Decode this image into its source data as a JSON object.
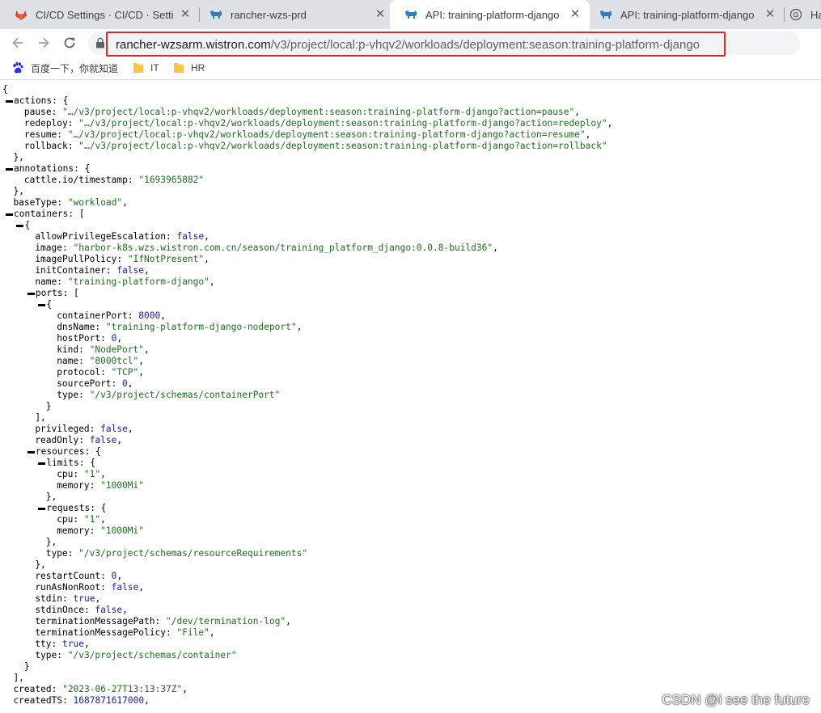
{
  "tabs": [
    {
      "title": "CI/CD Settings · CI/CD · Settings",
      "icon": "gitlab-icon",
      "active": false
    },
    {
      "title": "rancher-wzs-prd",
      "icon": "rancher-icon",
      "active": false
    },
    {
      "title": "API: training-platform-django",
      "icon": "rancher-icon",
      "active": true
    },
    {
      "title": "API: training-platform-django",
      "icon": "rancher-icon",
      "active": false
    },
    {
      "title": "Ha",
      "icon": "globe-icon",
      "active": false
    }
  ],
  "address_bar": {
    "host": "rancher-wzsarm.wistron.com",
    "path": "/v3/project/local:p-vhqv2/workloads/deployment:season:training-platform-django"
  },
  "bookmarks": [
    {
      "label": "百度一下，你就知道",
      "icon": "baidu-paw-icon"
    },
    {
      "label": "IT",
      "icon": "folder-icon"
    },
    {
      "label": "HR",
      "icon": "folder-icon"
    }
  ],
  "colors": {
    "highlight_border": "#d92b2b",
    "string": "#1e6e1e",
    "literal": "#1a1aa6"
  },
  "json_lines": [
    {
      "i": 0,
      "t": [
        [
          "p",
          "{"
        ]
      ]
    },
    {
      "i": 0,
      "c": true,
      "t": [
        [
          "k",
          "actions"
        ],
        [
          "p",
          ": {"
        ]
      ]
    },
    {
      "i": 4,
      "t": [
        [
          "k",
          "pause"
        ],
        [
          "p",
          ": "
        ],
        [
          "s",
          "\"…/v3/project/local:p-vhqv2/workloads/deployment:season:training-platform-django?action=pause\""
        ],
        [
          "p",
          ","
        ]
      ]
    },
    {
      "i": 4,
      "t": [
        [
          "k",
          "redeploy"
        ],
        [
          "p",
          ": "
        ],
        [
          "s",
          "\"…/v3/project/local:p-vhqv2/workloads/deployment:season:training-platform-django?action=redeploy\""
        ],
        [
          "p",
          ","
        ]
      ]
    },
    {
      "i": 4,
      "t": [
        [
          "k",
          "resume"
        ],
        [
          "p",
          ": "
        ],
        [
          "s",
          "\"…/v3/project/local:p-vhqv2/workloads/deployment:season:training-platform-django?action=resume\""
        ],
        [
          "p",
          ","
        ]
      ]
    },
    {
      "i": 4,
      "t": [
        [
          "k",
          "rollback"
        ],
        [
          "p",
          ": "
        ],
        [
          "s",
          "\"…/v3/project/local:p-vhqv2/workloads/deployment:season:training-platform-django?action=rollback\""
        ]
      ]
    },
    {
      "i": 2,
      "t": [
        [
          "p",
          "},"
        ]
      ]
    },
    {
      "i": 0,
      "c": true,
      "t": [
        [
          "k",
          "annotations"
        ],
        [
          "p",
          ": {"
        ]
      ]
    },
    {
      "i": 4,
      "t": [
        [
          "k",
          "cattle.io/timestamp"
        ],
        [
          "p",
          ": "
        ],
        [
          "s",
          "\"1693965882\""
        ]
      ]
    },
    {
      "i": 2,
      "t": [
        [
          "p",
          "},"
        ]
      ]
    },
    {
      "i": 2,
      "t": [
        [
          "k",
          "baseType"
        ],
        [
          "p",
          ": "
        ],
        [
          "s",
          "\"workload\""
        ],
        [
          "p",
          ","
        ]
      ]
    },
    {
      "i": 0,
      "c": true,
      "t": [
        [
          "k",
          "containers"
        ],
        [
          "p",
          ": ["
        ]
      ]
    },
    {
      "i": 2,
      "c": true,
      "t": [
        [
          "p",
          "{"
        ]
      ]
    },
    {
      "i": 6,
      "t": [
        [
          "k",
          "allowPrivilegeEscalation"
        ],
        [
          "p",
          ": "
        ],
        [
          "b",
          "false"
        ],
        [
          "p",
          ","
        ]
      ]
    },
    {
      "i": 6,
      "t": [
        [
          "k",
          "image"
        ],
        [
          "p",
          ": "
        ],
        [
          "s",
          "\"harbor-k8s.wzs.wistron.com.cn/season/training_platform_django:0.0.8-build36\""
        ],
        [
          "p",
          ","
        ]
      ]
    },
    {
      "i": 6,
      "t": [
        [
          "k",
          "imagePullPolicy"
        ],
        [
          "p",
          ": "
        ],
        [
          "s",
          "\"IfNotPresent\""
        ],
        [
          "p",
          ","
        ]
      ]
    },
    {
      "i": 6,
      "t": [
        [
          "k",
          "initContainer"
        ],
        [
          "p",
          ": "
        ],
        [
          "b",
          "false"
        ],
        [
          "p",
          ","
        ]
      ]
    },
    {
      "i": 6,
      "t": [
        [
          "k",
          "name"
        ],
        [
          "p",
          ": "
        ],
        [
          "s",
          "\"training-platform-django\""
        ],
        [
          "p",
          ","
        ]
      ]
    },
    {
      "i": 4,
      "c": true,
      "t": [
        [
          "k",
          "ports"
        ],
        [
          "p",
          ": ["
        ]
      ]
    },
    {
      "i": 6,
      "c": true,
      "t": [
        [
          "p",
          "{"
        ]
      ]
    },
    {
      "i": 10,
      "t": [
        [
          "k",
          "containerPort"
        ],
        [
          "p",
          ": "
        ],
        [
          "n",
          "8000"
        ],
        [
          "p",
          ","
        ]
      ]
    },
    {
      "i": 10,
      "t": [
        [
          "k",
          "dnsName"
        ],
        [
          "p",
          ": "
        ],
        [
          "s",
          "\"training-platform-django-nodeport\""
        ],
        [
          "p",
          ","
        ]
      ]
    },
    {
      "i": 10,
      "t": [
        [
          "k",
          "hostPort"
        ],
        [
          "p",
          ": "
        ],
        [
          "n",
          "0"
        ],
        [
          "p",
          ","
        ]
      ]
    },
    {
      "i": 10,
      "t": [
        [
          "k",
          "kind"
        ],
        [
          "p",
          ": "
        ],
        [
          "s",
          "\"NodePort\""
        ],
        [
          "p",
          ","
        ]
      ]
    },
    {
      "i": 10,
      "t": [
        [
          "k",
          "name"
        ],
        [
          "p",
          ": "
        ],
        [
          "s",
          "\"8000tcl\""
        ],
        [
          "p",
          ","
        ]
      ]
    },
    {
      "i": 10,
      "t": [
        [
          "k",
          "protocol"
        ],
        [
          "p",
          ": "
        ],
        [
          "s",
          "\"TCP\""
        ],
        [
          "p",
          ","
        ]
      ]
    },
    {
      "i": 10,
      "t": [
        [
          "k",
          "sourcePort"
        ],
        [
          "p",
          ": "
        ],
        [
          "n",
          "0"
        ],
        [
          "p",
          ","
        ]
      ]
    },
    {
      "i": 10,
      "t": [
        [
          "k",
          "type"
        ],
        [
          "p",
          ": "
        ],
        [
          "s",
          "\"/v3/project/schemas/containerPort\""
        ]
      ]
    },
    {
      "i": 8,
      "t": [
        [
          "p",
          "}"
        ]
      ]
    },
    {
      "i": 6,
      "t": [
        [
          "p",
          "],"
        ]
      ]
    },
    {
      "i": 6,
      "t": [
        [
          "k",
          "privileged"
        ],
        [
          "p",
          ": "
        ],
        [
          "b",
          "false"
        ],
        [
          "p",
          ","
        ]
      ]
    },
    {
      "i": 6,
      "t": [
        [
          "k",
          "readOnly"
        ],
        [
          "p",
          ": "
        ],
        [
          "b",
          "false"
        ],
        [
          "p",
          ","
        ]
      ]
    },
    {
      "i": 4,
      "c": true,
      "t": [
        [
          "k",
          "resources"
        ],
        [
          "p",
          ": {"
        ]
      ]
    },
    {
      "i": 6,
      "c": true,
      "t": [
        [
          "k",
          "limits"
        ],
        [
          "p",
          ": {"
        ]
      ]
    },
    {
      "i": 10,
      "t": [
        [
          "k",
          "cpu"
        ],
        [
          "p",
          ": "
        ],
        [
          "s",
          "\"1\""
        ],
        [
          "p",
          ","
        ]
      ]
    },
    {
      "i": 10,
      "t": [
        [
          "k",
          "memory"
        ],
        [
          "p",
          ": "
        ],
        [
          "s",
          "\"1000Mi\""
        ]
      ]
    },
    {
      "i": 8,
      "t": [
        [
          "p",
          "},"
        ]
      ]
    },
    {
      "i": 6,
      "c": true,
      "t": [
        [
          "k",
          "requests"
        ],
        [
          "p",
          ": {"
        ]
      ]
    },
    {
      "i": 10,
      "t": [
        [
          "k",
          "cpu"
        ],
        [
          "p",
          ": "
        ],
        [
          "s",
          "\"1\""
        ],
        [
          "p",
          ","
        ]
      ]
    },
    {
      "i": 10,
      "t": [
        [
          "k",
          "memory"
        ],
        [
          "p",
          ": "
        ],
        [
          "s",
          "\"1000Mi\""
        ]
      ]
    },
    {
      "i": 8,
      "t": [
        [
          "p",
          "},"
        ]
      ]
    },
    {
      "i": 8,
      "t": [
        [
          "k",
          "type"
        ],
        [
          "p",
          ": "
        ],
        [
          "s",
          "\"/v3/project/schemas/resourceRequirements\""
        ]
      ]
    },
    {
      "i": 6,
      "t": [
        [
          "p",
          "},"
        ]
      ]
    },
    {
      "i": 6,
      "t": [
        [
          "k",
          "restartCount"
        ],
        [
          "p",
          ": "
        ],
        [
          "n",
          "0"
        ],
        [
          "p",
          ","
        ]
      ]
    },
    {
      "i": 6,
      "t": [
        [
          "k",
          "runAsNonRoot"
        ],
        [
          "p",
          ": "
        ],
        [
          "b",
          "false"
        ],
        [
          "p",
          ","
        ]
      ]
    },
    {
      "i": 6,
      "t": [
        [
          "k",
          "stdin"
        ],
        [
          "p",
          ": "
        ],
        [
          "b",
          "true"
        ],
        [
          "p",
          ","
        ]
      ]
    },
    {
      "i": 6,
      "t": [
        [
          "k",
          "stdinOnce"
        ],
        [
          "p",
          ": "
        ],
        [
          "b",
          "false"
        ],
        [
          "p",
          ","
        ]
      ]
    },
    {
      "i": 6,
      "t": [
        [
          "k",
          "terminationMessagePath"
        ],
        [
          "p",
          ": "
        ],
        [
          "s",
          "\"/dev/termination-log\""
        ],
        [
          "p",
          ","
        ]
      ]
    },
    {
      "i": 6,
      "t": [
        [
          "k",
          "terminationMessagePolicy"
        ],
        [
          "p",
          ": "
        ],
        [
          "s",
          "\"File\""
        ],
        [
          "p",
          ","
        ]
      ]
    },
    {
      "i": 6,
      "t": [
        [
          "k",
          "tty"
        ],
        [
          "p",
          ": "
        ],
        [
          "b",
          "true"
        ],
        [
          "p",
          ","
        ]
      ]
    },
    {
      "i": 6,
      "t": [
        [
          "k",
          "type"
        ],
        [
          "p",
          ": "
        ],
        [
          "s",
          "\"/v3/project/schemas/container\""
        ]
      ]
    },
    {
      "i": 4,
      "t": [
        [
          "p",
          "}"
        ]
      ]
    },
    {
      "i": 2,
      "t": [
        [
          "p",
          "],"
        ]
      ]
    },
    {
      "i": 2,
      "t": [
        [
          "k",
          "created"
        ],
        [
          "p",
          ": "
        ],
        [
          "s",
          "\"2023-06-27T13:13:37Z\""
        ],
        [
          "p",
          ","
        ]
      ]
    },
    {
      "i": 2,
      "t": [
        [
          "k",
          "createdTS"
        ],
        [
          "p",
          ": "
        ],
        [
          "n",
          "1687871617000"
        ],
        [
          "p",
          ","
        ]
      ]
    }
  ],
  "watermark": "CSDN @i see the future"
}
